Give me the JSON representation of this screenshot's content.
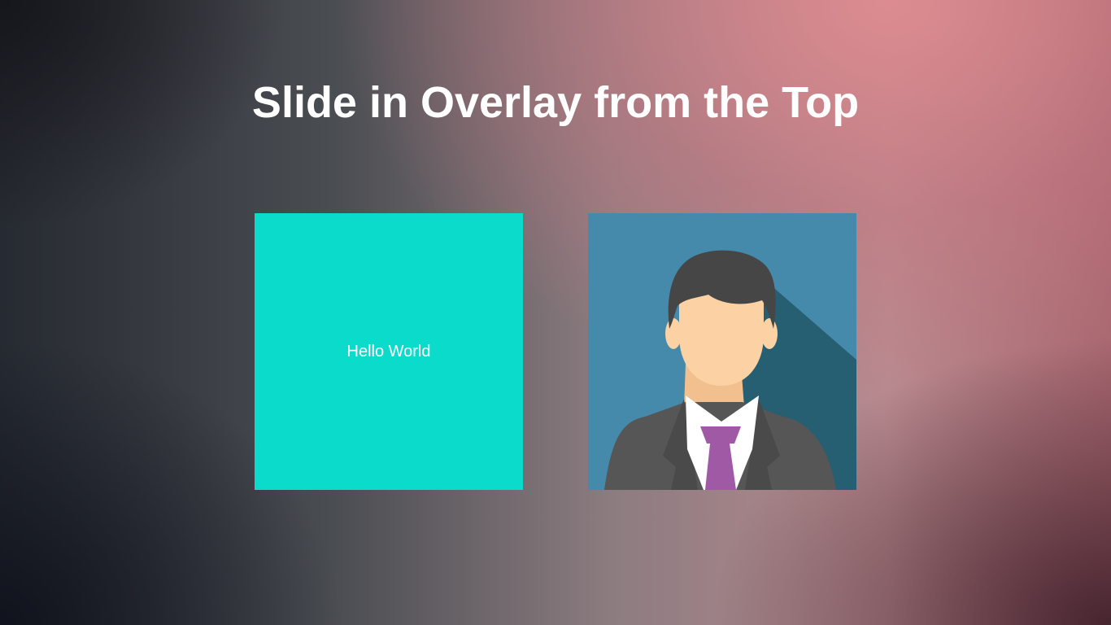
{
  "page": {
    "title": "Slide in Overlay from the Top"
  },
  "cards": [
    {
      "kind": "text",
      "text": "Hello World",
      "background": "#0bdbca"
    },
    {
      "kind": "image",
      "icon": "businessman-avatar-icon",
      "background": "#468aab"
    }
  ],
  "colors": {
    "title_text": "#ffffff",
    "avatar_hair": "#464646",
    "avatar_skin": "#fcd1a3",
    "avatar_suit": "#565656",
    "avatar_shirt": "#ffffff",
    "avatar_tie": "#a05aa5",
    "avatar_shadow": "#265e72"
  }
}
